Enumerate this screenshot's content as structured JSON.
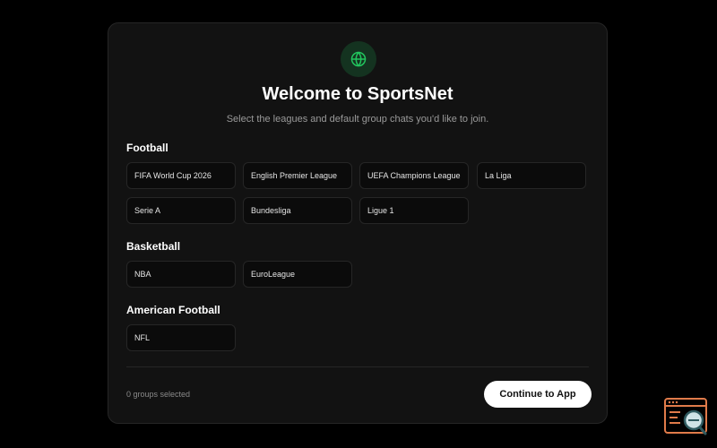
{
  "header": {
    "title": "Welcome to SportsNet",
    "subtitle": "Select the leagues and default group chats you'd like to join."
  },
  "sections": [
    {
      "title": "Football",
      "leagues": [
        "FIFA World Cup 2026",
        "English Premier League",
        "UEFA Champions League",
        "La Liga",
        "Serie A",
        "Bundesliga",
        "Ligue 1"
      ]
    },
    {
      "title": "Basketball",
      "leagues": [
        "NBA",
        "EuroLeague"
      ]
    },
    {
      "title": "American Football",
      "leagues": [
        "NFL"
      ]
    }
  ],
  "footer": {
    "selected_count": "0 groups selected",
    "continue_label": "Continue to App"
  },
  "icons": {
    "header_icon": "globe-icon",
    "corner_widget": "browser-search-icon"
  },
  "colors": {
    "accent": "#22c55e",
    "background": "#000000",
    "card": "#121212",
    "widget": "#e07b4a"
  }
}
